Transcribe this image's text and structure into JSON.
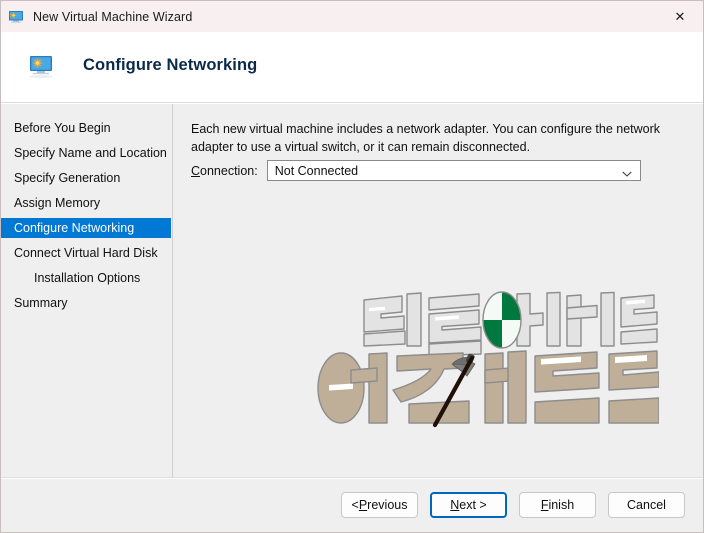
{
  "window": {
    "title": "New Virtual Machine Wizard",
    "titlebar_icon": "virtual-machine-icon",
    "close_label": "✕",
    "titlebar_bg": "#f7eff0",
    "body_bg": "#efefef"
  },
  "header": {
    "icon": "virtual-machine-icon",
    "title": "Configure Networking"
  },
  "sidebar": {
    "items": [
      {
        "label": "Before You Begin",
        "active": false,
        "indent": false
      },
      {
        "label": "Specify Name and Location",
        "active": false,
        "indent": false
      },
      {
        "label": "Specify Generation",
        "active": false,
        "indent": false
      },
      {
        "label": "Assign Memory",
        "active": false,
        "indent": false
      },
      {
        "label": "Configure Networking",
        "active": true,
        "indent": false
      },
      {
        "label": "Connect Virtual Hard Disk",
        "active": false,
        "indent": false
      },
      {
        "label": "Installation Options",
        "active": false,
        "indent": true
      },
      {
        "label": "Summary",
        "active": false,
        "indent": false
      }
    ],
    "accent_color": "#0078d4"
  },
  "main": {
    "description": "Each new virtual machine includes a network adapter. You can configure the network adapter to use a virtual switch, or it can remain disconnected.",
    "connection": {
      "label_prefix": "",
      "label_accel": "C",
      "label_suffix": "onnection:",
      "value": "Not Connected",
      "options": [
        "Not Connected"
      ],
      "chevron_icon": "chevron-down-icon"
    },
    "watermark": {
      "line1_text": "만들어가는",
      "line2_text": "아스가르드",
      "line1_fill": "#e2e2e2",
      "line2_fill": "#bfae98",
      "stroke": "#8d8d8d",
      "emblem_color": "#00793f",
      "axe_handle_color": "#201008",
      "axe_head_color": "#7d7d7d"
    }
  },
  "footer": {
    "buttons": [
      {
        "name": "previous-button",
        "pre": "< ",
        "accel": "P",
        "post": "revious",
        "default": false
      },
      {
        "name": "next-button",
        "pre": "",
        "accel": "N",
        "post": "ext >",
        "default": true
      },
      {
        "name": "finish-button",
        "pre": "",
        "accel": "F",
        "post": "inish",
        "default": false
      },
      {
        "name": "cancel-button",
        "pre": "Cancel",
        "accel": "",
        "post": "",
        "default": false
      }
    ],
    "focus_color": "#0067c0"
  }
}
